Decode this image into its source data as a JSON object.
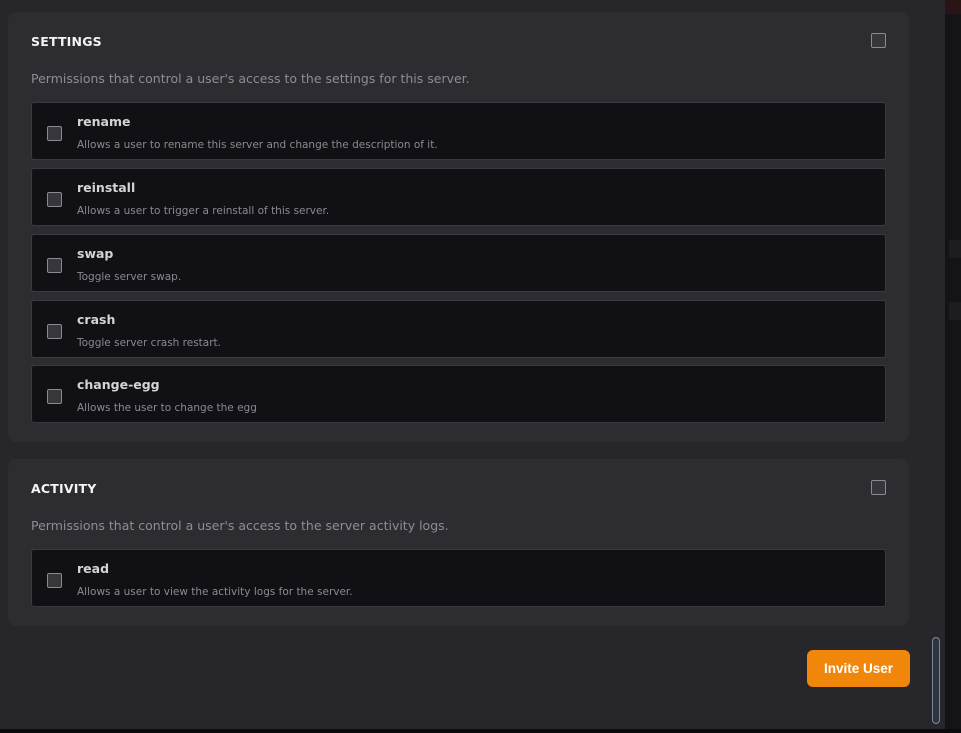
{
  "sections": [
    {
      "title": "SETTINGS",
      "description": "Permissions that control a user's access to the settings for this server.",
      "permissions": [
        {
          "name": "rename",
          "description": "Allows a user to rename this server and change the description of it."
        },
        {
          "name": "reinstall",
          "description": "Allows a user to trigger a reinstall of this server."
        },
        {
          "name": "swap",
          "description": "Toggle server swap."
        },
        {
          "name": "crash",
          "description": "Toggle server crash restart."
        },
        {
          "name": "change-egg",
          "description": "Allows the user to change the egg"
        }
      ]
    },
    {
      "title": "ACTIVITY",
      "description": "Permissions that control a user's access to the server activity logs.",
      "permissions": [
        {
          "name": "read",
          "description": "Allows a user to view the activity logs for the server."
        }
      ]
    }
  ],
  "actions": {
    "invite_label": "Invite User"
  },
  "colors": {
    "accent": "#f0870b",
    "panel": "#2c2c31",
    "row": "#111015"
  }
}
